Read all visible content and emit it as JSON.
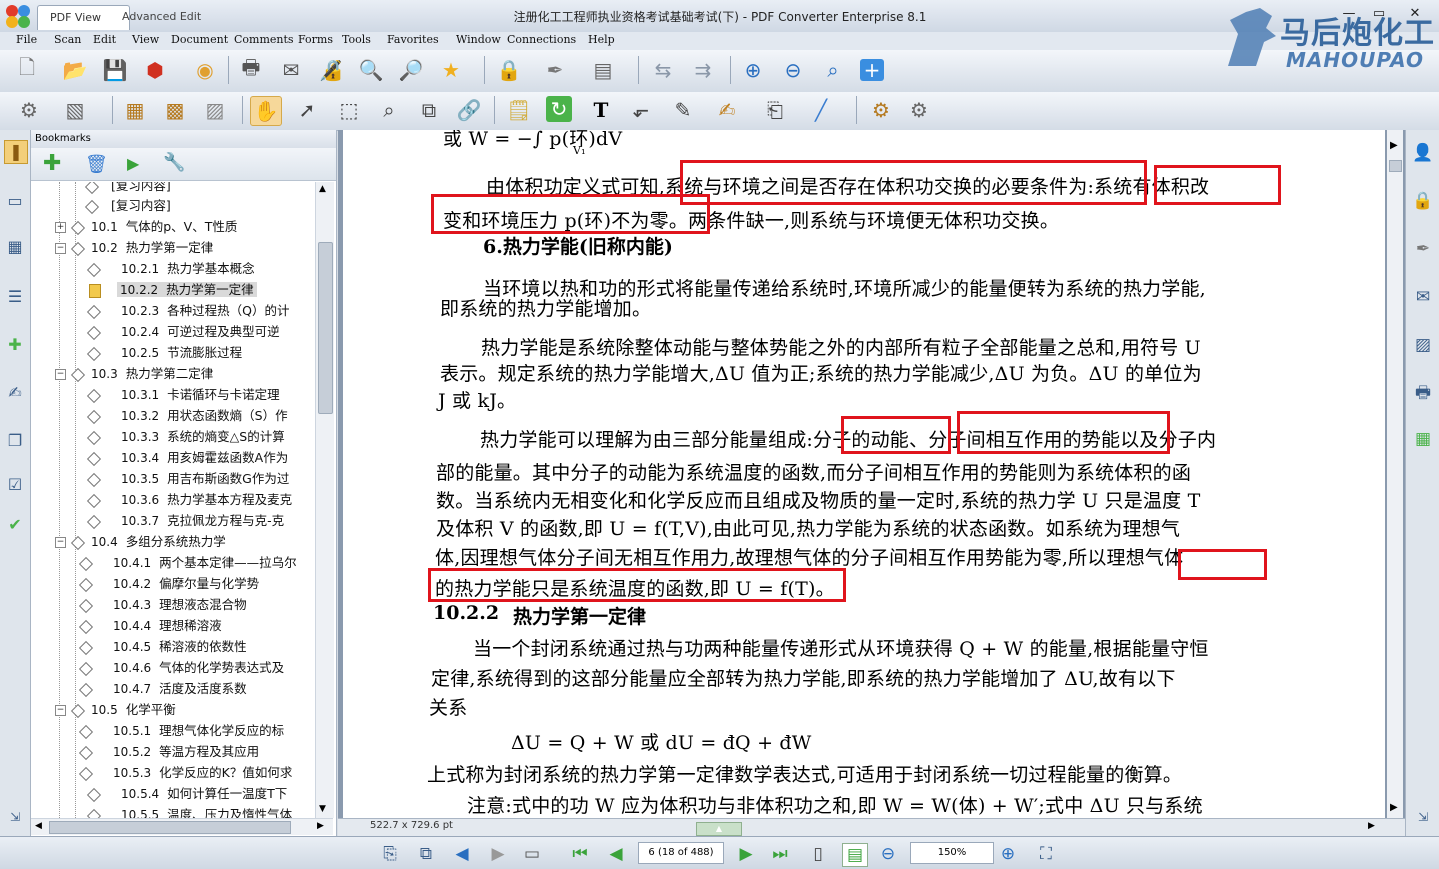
{
  "titlebar": {
    "tab_pdf_view": "PDF View",
    "tab_advanced_edit": "Advanced Edit",
    "window_title": "注册化工工程师执业资格考试基础考试(下) - PDF Converter Enterprise 8.1",
    "min": "—",
    "max": "▭",
    "close": "✕"
  },
  "brand": {
    "cn": "马后炮化工",
    "en": "MAHOUPAO"
  },
  "menu": [
    "File",
    "Scan",
    "Edit",
    "View",
    "Document",
    "Comments",
    "Forms",
    "Tools",
    "Favorites",
    "Window",
    "Connections",
    "Help"
  ],
  "bookmarks": {
    "header": "Bookmarks",
    "rows": [
      {
        "num": "",
        "label": "[复习内容]",
        "level": 1
      },
      {
        "num": "",
        "label": "[复习内容]",
        "level": 1
      },
      {
        "num": "10.1",
        "label": "气体的p、V、T性质",
        "level": 0
      },
      {
        "num": "10.2",
        "label": "热力学第一定律",
        "level": 0
      },
      {
        "num": "10.2.1",
        "label": "热力学基本概念",
        "level": 2
      },
      {
        "num": "10.2.2",
        "label": "热力学第一定律",
        "level": 2
      },
      {
        "num": "10.2.3",
        "label": "各种过程热（Q）的计",
        "level": 2
      },
      {
        "num": "10.2.4",
        "label": "可逆过程及典型可逆",
        "level": 2
      },
      {
        "num": "10.2.5",
        "label": "节流膨胀过程",
        "level": 2
      },
      {
        "num": "10.3",
        "label": "热力学第二定律",
        "level": 0
      },
      {
        "num": "10.3.1",
        "label": "卡诺循环与卡诺定理",
        "level": 2
      },
      {
        "num": "10.3.2",
        "label": "用状态函数熵（S）作",
        "level": 2
      },
      {
        "num": "10.3.3",
        "label": "系统的熵变△S的计算",
        "level": 2
      },
      {
        "num": "10.3.4",
        "label": "用亥姆霍兹函数A作为",
        "level": 2
      },
      {
        "num": "10.3.5",
        "label": "用吉布斯函数G作为过",
        "level": 2
      },
      {
        "num": "10.3.6",
        "label": "热力学基本方程及麦克",
        "level": 2
      },
      {
        "num": "10.3.7",
        "label": "克拉佩龙方程与克-克",
        "level": 2
      },
      {
        "num": "10.4",
        "label": "多组分系统热力学",
        "level": 0
      },
      {
        "num": "10.4.1",
        "label": "两个基本定律——拉乌尔",
        "level": 2
      },
      {
        "num": "10.4.2",
        "label": "偏摩尔量与化学势",
        "level": 2
      },
      {
        "num": "10.4.3",
        "label": "理想液态混合物",
        "level": 2
      },
      {
        "num": "10.4.4",
        "label": "理想稀溶液",
        "level": 2
      },
      {
        "num": "10.4.5",
        "label": "稀溶液的依数性",
        "level": 2
      },
      {
        "num": "10.4.6",
        "label": "气体的化学势表达式及",
        "level": 2
      },
      {
        "num": "10.4.7",
        "label": "活度及活度系数",
        "level": 2
      },
      {
        "num": "10.5",
        "label": "化学平衡",
        "level": 0
      },
      {
        "num": "10.5.1",
        "label": "理想气体化学反应的标",
        "level": 2
      },
      {
        "num": "10.5.2",
        "label": "等温方程及其应用",
        "level": 2
      },
      {
        "num": "10.5.3",
        "label": "化学反应的K？值如何求",
        "level": 2
      },
      {
        "num": "10.5.4",
        "label": "如何计算任一温度T下",
        "level": 3
      },
      {
        "num": "10.5.5",
        "label": "温度、压力及惰性气体",
        "level": 3
      }
    ]
  },
  "page": {
    "l0": "或    W = −∫ p(环)dV",
    "l0_sub": "V₁",
    "l1": "由体积功定义式可知,系统与环境之间是否存在体积功交换的必要条件为:系统有体积改",
    "l2": "变和环境压力 p(环)不为零。两条件缺一,则系统与环境便无体积功交换。",
    "h1": "6.热力学能(旧称内能)",
    "l3": "当环境以热和功的形式将能量传递给系统时,环境所减少的能量便转为系统的热力学能,",
    "l4": "即系统的热力学能增加。",
    "l5": "热力学能是系统除整体动能与整体势能之外的内部所有粒子全部能量之总和,用符号 U",
    "l6": "表示。规定系统的热力学能增大,ΔU 值为正;系统的热力学能减少,ΔU 为负。ΔU 的单位为",
    "l7": "J 或 kJ。",
    "l8": "热力学能可以理解为由三部分能量组成:分子的动能、分子间相互作用的势能以及分子内",
    "l9": "部的能量。其中分子的动能为系统温度的函数,而分子间相互作用的势能则为系统体积的函",
    "l10": "数。当系统内无相变化和化学反应而且组成及物质的量一定时,系统的热力学 U 只是温度 T",
    "l11": "及体积 V 的函数,即 U = f(T,V),由此可见,热力学能为系统的状态函数。如系统为理想气",
    "l12": "体,因理想气体分子间无相互作用力,故理想气体的分子间相互作用势能为零,所以理想气体",
    "l13": "的热力学能只是系统温度的函数,即 U = f(T)。",
    "h2_num": "10.2.2",
    "h2": "热力学第一定律",
    "l14": "当一个封闭系统通过热与功两种能量传递形式从环境获得 Q + W 的能量,根据能量守恒",
    "l15": "定律,系统得到的这部分能量应全部转为热力学能,即系统的热力学能增加了 ΔU,故有以下",
    "l16": "关系",
    "eq": "ΔU = Q + W     或    dU = đQ + đW",
    "l17": "上式称为封闭系统的热力学第一定律数学表达式,可适用于封闭系统一切过程能量的衡算。",
    "l18": "注意:式中的功 W 应为体积功与非体积功之和,即 W = W(体) + W′;式中 ΔU 只与系统"
  },
  "status": {
    "page_size": "522.7 x 729.6 pt",
    "page_indicator": "6 (18 of 488)",
    "zoom": "150%"
  },
  "colors": {
    "highlight_box": "#e0141c"
  }
}
